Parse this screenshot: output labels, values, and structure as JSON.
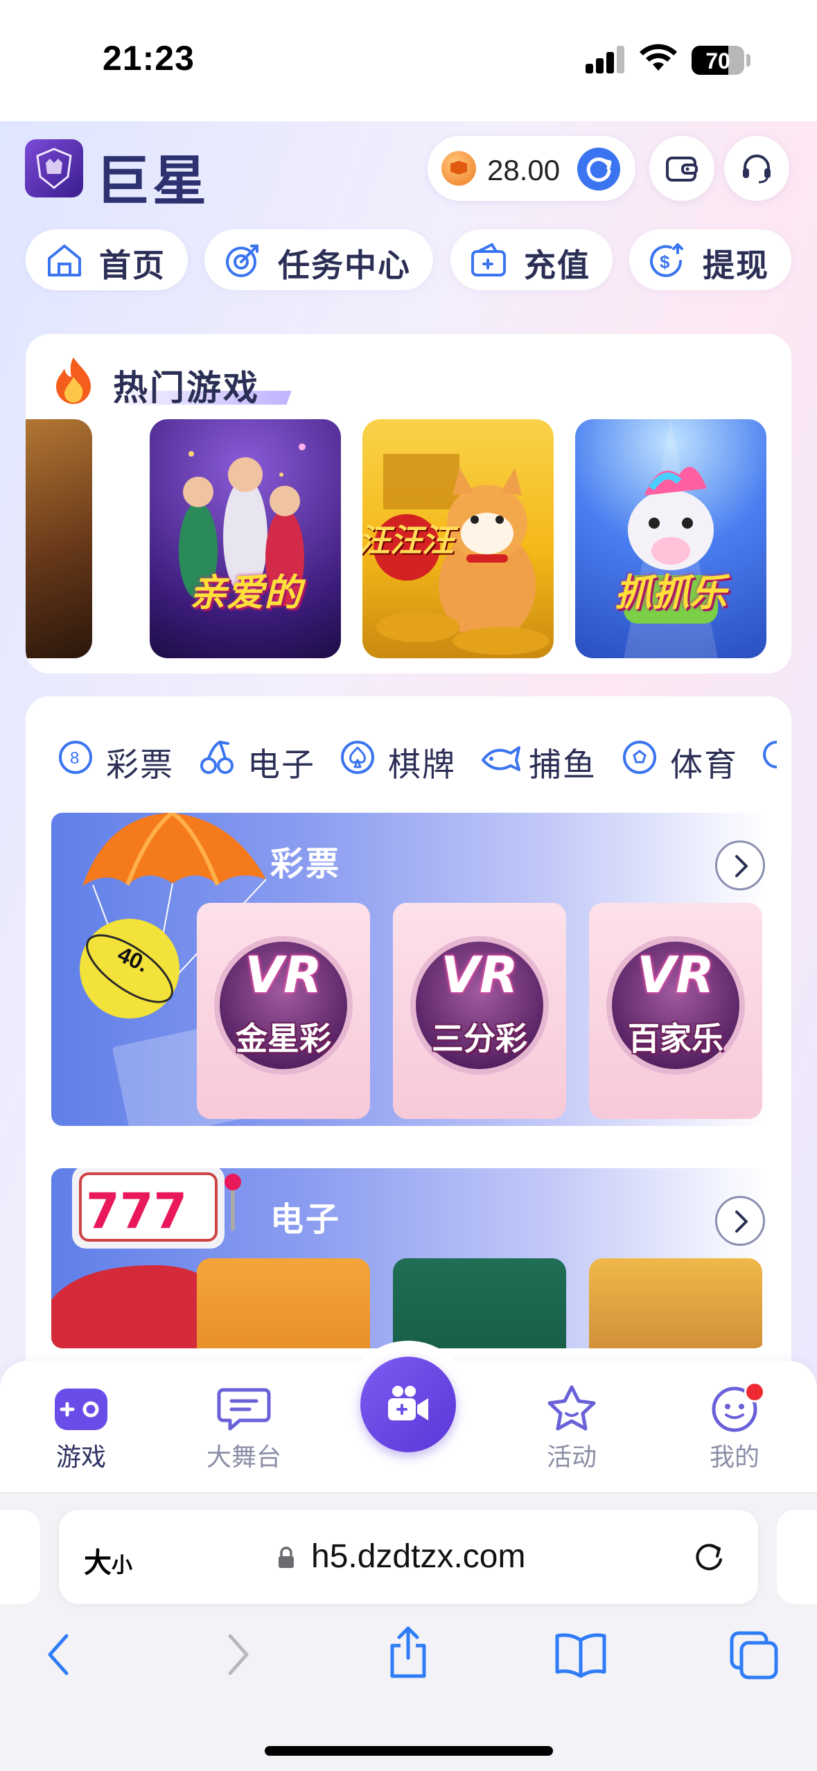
{
  "status_bar": {
    "time": "21:23",
    "battery": "70",
    "battery_level": 0.7
  },
  "header": {
    "brand": "巨星",
    "balance": "28.00",
    "icons": [
      "crest-logo-icon",
      "coin-icon",
      "refresh-icon",
      "wallet-icon",
      "headset-icon"
    ]
  },
  "nav": {
    "items": [
      {
        "label": "首页",
        "icon": "home-icon"
      },
      {
        "label": "任务中心",
        "icon": "target-icon"
      },
      {
        "label": "充值",
        "icon": "wallet-add-icon"
      },
      {
        "label": "提现",
        "icon": "dollar-withdraw-icon"
      }
    ]
  },
  "hot_games": {
    "title": "热门游戏",
    "games": [
      {
        "label": ""
      },
      {
        "label": "亲爱的"
      },
      {
        "label": "汪汪汪"
      },
      {
        "label": "抓抓乐"
      }
    ]
  },
  "categories": {
    "tabs": [
      {
        "label": "彩票",
        "icon": "lottery-ball-icon"
      },
      {
        "label": "电子",
        "icon": "cherries-icon"
      },
      {
        "label": "棋牌",
        "icon": "spade-icon"
      },
      {
        "label": "捕鱼",
        "icon": "fish-icon"
      },
      {
        "label": "体育",
        "icon": "soccer-ball-icon"
      }
    ]
  },
  "sections": {
    "lottery": {
      "title": "彩票",
      "ball_text": "40.",
      "tiles": [
        {
          "logo": "VR",
          "name": "金星彩"
        },
        {
          "logo": "VR",
          "name": "三分彩"
        },
        {
          "logo": "VR",
          "name": "百家乐"
        }
      ]
    },
    "electronic": {
      "title": "电子",
      "slot_text": "777"
    }
  },
  "tabbar": {
    "items": [
      {
        "label": "游戏",
        "active": true
      },
      {
        "label": "大舞台",
        "active": false
      },
      {
        "label": "活动",
        "active": false
      },
      {
        "label": "我的",
        "active": false
      }
    ]
  },
  "browser": {
    "text_size_label": "大",
    "text_size_small": "小",
    "url": "h5.dzdtzx.com"
  },
  "colors": {
    "accent": "#5a36d8",
    "brand_text": "#2d3170",
    "refresh": "#3a74f0",
    "badge": "#ee2b35"
  }
}
